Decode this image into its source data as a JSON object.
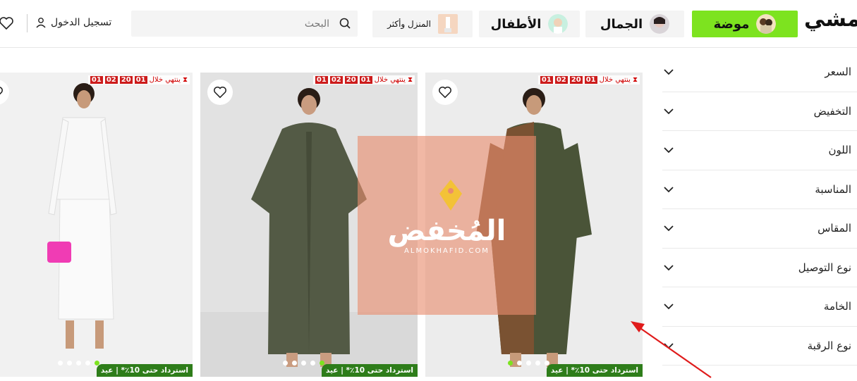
{
  "header": {
    "logo": "نمشي",
    "categories": [
      {
        "label": "موضة"
      },
      {
        "label": "الجمال"
      },
      {
        "label": "الأطفال"
      },
      {
        "label": "المنزل وأكثر"
      }
    ],
    "search": {
      "placeholder": "البحث"
    },
    "login_label": "تسجيل الدخول"
  },
  "filters": [
    {
      "label": "السعر"
    },
    {
      "label": "التخفيض"
    },
    {
      "label": "اللون"
    },
    {
      "label": "المناسبة"
    },
    {
      "label": "المقاس"
    },
    {
      "label": "نوع التوصيل"
    },
    {
      "label": "الخامة"
    },
    {
      "label": "نوع الرقبة"
    }
  ],
  "products": [
    {
      "timer_label": "ينتهي خلال",
      "timer": [
        "01",
        "02",
        "20",
        "01"
      ],
      "promo": "استرداد حتى 10٪* | عيد",
      "active_image": 1
    },
    {
      "timer_label": "ينتهي خلال",
      "timer": [
        "01",
        "02",
        "20",
        "01"
      ],
      "promo": "استرداد حتى 10٪* | عيد",
      "active_image": 1
    },
    {
      "timer_label": "ينتهي خلال",
      "timer": [
        "01",
        "02",
        "20",
        "01"
      ],
      "promo": "استرداد حتى 10٪* | عيد",
      "active_image": 1
    }
  ],
  "watermark": {
    "title": "المُخفض",
    "url": "ALMOKHAFID.COM"
  },
  "colors": {
    "accent": "#7de31f",
    "promo": "#2e7d1a",
    "timer": "#cc1b1b"
  }
}
